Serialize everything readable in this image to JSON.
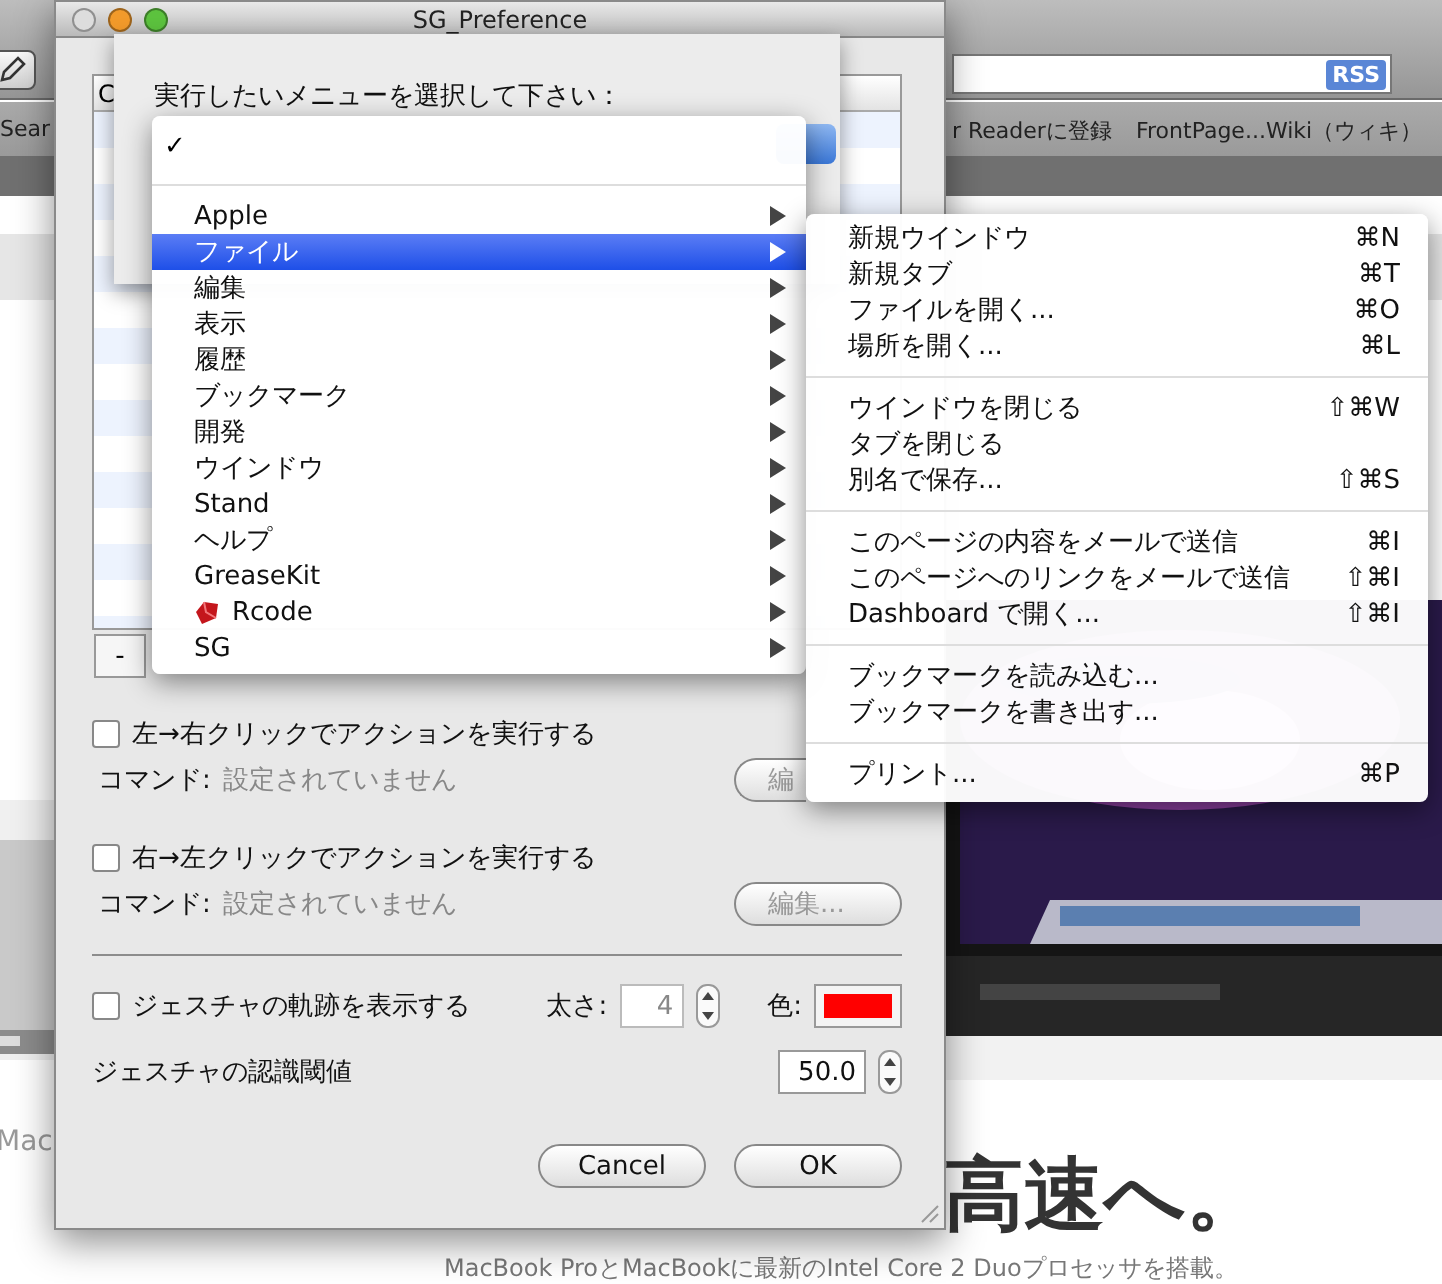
{
  "browser": {
    "bookmarks": [
      "Sear",
      "r Readerに登録",
      "FrontPage...Wiki（ウィキ）"
    ],
    "rss": "RSS",
    "page": {
      "left_fragment": "Mac",
      "headline": "高速へ。",
      "caption": "MacBook ProとMacBookに最新のIntel Core 2 Duoプロセッサを搭載。"
    }
  },
  "dialog": {
    "title": "SG_Preference",
    "list": {
      "header": "C"
    },
    "remove_button": "-",
    "options": [
      {
        "label": "左→右クリックでアクションを実行する",
        "checked": false,
        "command_label": "コマンド:",
        "command_value": "設定されていません",
        "edit_button": "編"
      },
      {
        "label": "右→左クリックでアクションを実行する",
        "checked": false,
        "command_label": "コマンド:",
        "command_value": "設定されていません",
        "edit_button": "編集..."
      }
    ],
    "trail": {
      "label": "ジェスチャの軌跡を表示する",
      "checked": false,
      "width_label": "太さ:",
      "width_value": "4",
      "color_label": "色:",
      "color": "#ff0000"
    },
    "threshold": {
      "label": "ジェスチャの認識閾値",
      "value": "50.0"
    },
    "buttons": [
      "Cancel",
      "OK"
    ]
  },
  "sheet": {
    "prompt": "実行したいメニューを選択して下さい："
  },
  "menu": {
    "check_mark": "✓",
    "items": [
      {
        "label": "Apple",
        "selected": false,
        "kind": "plain"
      },
      {
        "label": "ファイル",
        "selected": true,
        "kind": "plain"
      },
      {
        "label": "編集",
        "selected": false,
        "kind": "plain"
      },
      {
        "label": "表示",
        "selected": false,
        "kind": "plain"
      },
      {
        "label": "履歴",
        "selected": false,
        "kind": "plain"
      },
      {
        "label": "ブックマーク",
        "selected": false,
        "kind": "plain"
      },
      {
        "label": "開発",
        "selected": false,
        "kind": "plain"
      },
      {
        "label": "ウインドウ",
        "selected": false,
        "kind": "plain"
      },
      {
        "label": "Stand",
        "selected": false,
        "kind": "plain"
      },
      {
        "label": "ヘルプ",
        "selected": false,
        "kind": "plain"
      },
      {
        "label": "GreaseKit",
        "selected": false,
        "kind": "plain"
      },
      {
        "label": "Rcode",
        "selected": false,
        "kind": "icon"
      },
      {
        "label": "SG",
        "selected": false,
        "kind": "plain"
      }
    ]
  },
  "submenu": {
    "groups": [
      [
        {
          "label": "新規ウインドウ",
          "shortcut": "⌘N"
        },
        {
          "label": "新規タブ",
          "shortcut": "⌘T"
        },
        {
          "label": "ファイルを開く...",
          "shortcut": "⌘O"
        },
        {
          "label": "場所を開く...",
          "shortcut": "⌘L"
        }
      ],
      [
        {
          "label": "ウインドウを閉じる",
          "shortcut": "⇧⌘W"
        },
        {
          "label": "タブを閉じる"
        },
        {
          "label": "別名で保存...",
          "shortcut": "⇧⌘S"
        }
      ],
      [
        {
          "label": "このページの内容をメールで送信",
          "shortcut": "⌘I"
        },
        {
          "label": "このページへのリンクをメールで送信",
          "shortcut": "⇧⌘I"
        },
        {
          "label": "Dashboard で開く...",
          "shortcut": "⇧⌘I"
        }
      ],
      [
        {
          "label": "ブックマークを読み込む..."
        },
        {
          "label": "ブックマークを書き出す..."
        }
      ],
      [
        {
          "label": "プリント...",
          "shortcut": "⌘P"
        }
      ]
    ]
  }
}
